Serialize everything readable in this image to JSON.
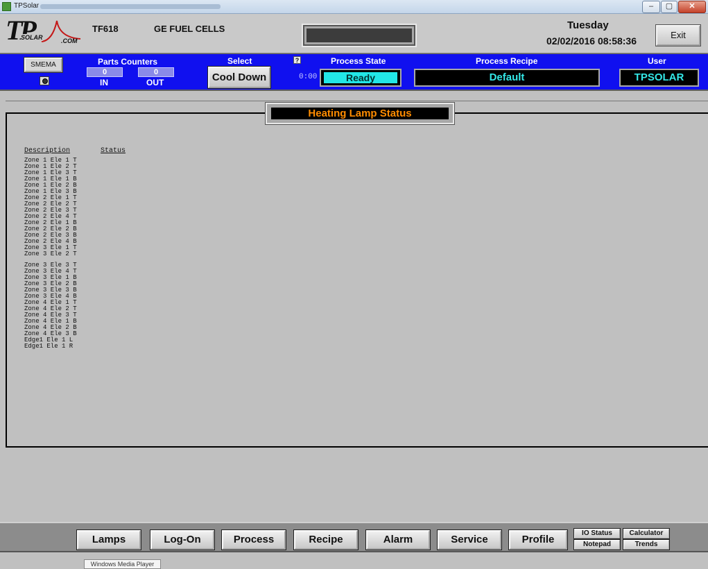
{
  "window": {
    "title": "TPSolar",
    "controls": {
      "minimize": "–",
      "maximize": "▢",
      "close": "✕"
    }
  },
  "header": {
    "logo": {
      "main": "TP",
      "sub": "SOLAR",
      "domain": ".COM"
    },
    "model": "TF618",
    "customer": "GE FUEL CELLS",
    "day": "Tuesday",
    "datetime": "02/02/2016 08:58:36",
    "exit_label": "Exit"
  },
  "statusbar": {
    "smema_label": "SMEMA",
    "parts_counters_label": "Parts Counters",
    "in_count": "0",
    "in_label": "IN",
    "out_count": "0",
    "out_label": "OUT",
    "select_label": "Select",
    "select_button": "Cool Down",
    "help_glyph": "?",
    "timer": "0:00",
    "process_state_label": "Process State",
    "process_state": "Ready",
    "process_recipe_label": "Process Recipe",
    "process_recipe": "Default",
    "user_label": "User",
    "user": "TPSOLAR"
  },
  "panel": {
    "title": "Heating Lamp Status",
    "col_description": "Description",
    "col_status": "Status",
    "rows_a": [
      "Zone 1 Ele 1 T",
      "Zone 1 Ele 2 T",
      "Zone 1 Ele 3 T",
      "Zone 1 Ele 1 B",
      "Zone 1 Ele 2 B",
      "Zone 1 Ele 3 B",
      "Zone 2 Ele 1 T",
      "Zone 2 Ele 2 T",
      "Zone 2 Ele 3 T",
      "Zone 2 Ele 4 T",
      "Zone 2 Ele 1 B",
      "Zone 2 Ele 2 B",
      "Zone 2 Ele 3 B",
      "Zone 2 Ele 4 B",
      "Zone 3 Ele 1 T",
      "Zone 3 Ele 2 T"
    ],
    "rows_b": [
      "Zone 3 Ele 3 T",
      "Zone 3 Ele 4 T",
      "Zone 3 Ele 1 B",
      "Zone 3 Ele 2 B",
      "Zone 3 Ele 3 B",
      "Zone 3 Ele 4 B",
      "Zone 4 Ele 1 T",
      "Zone 4 Ele 2 T",
      "Zone 4 Ele 3 T",
      "Zone 4 Ele 1 B",
      "Zone 4 Ele 2 B",
      "Zone 4 Ele 3 B",
      "Edge1 Ele 1 L",
      "Edge1 Ele 1 R"
    ]
  },
  "toolbar": {
    "lamps": "Lamps",
    "logon": "Log-On",
    "process": "Process",
    "recipe": "Recipe",
    "alarm": "Alarm",
    "service": "Service",
    "profile": "Profile",
    "io_status": "IO Status",
    "calculator": "Calculator",
    "notepad": "Notepad",
    "trends": "Trends"
  },
  "tooltip": "Windows Media Player"
}
